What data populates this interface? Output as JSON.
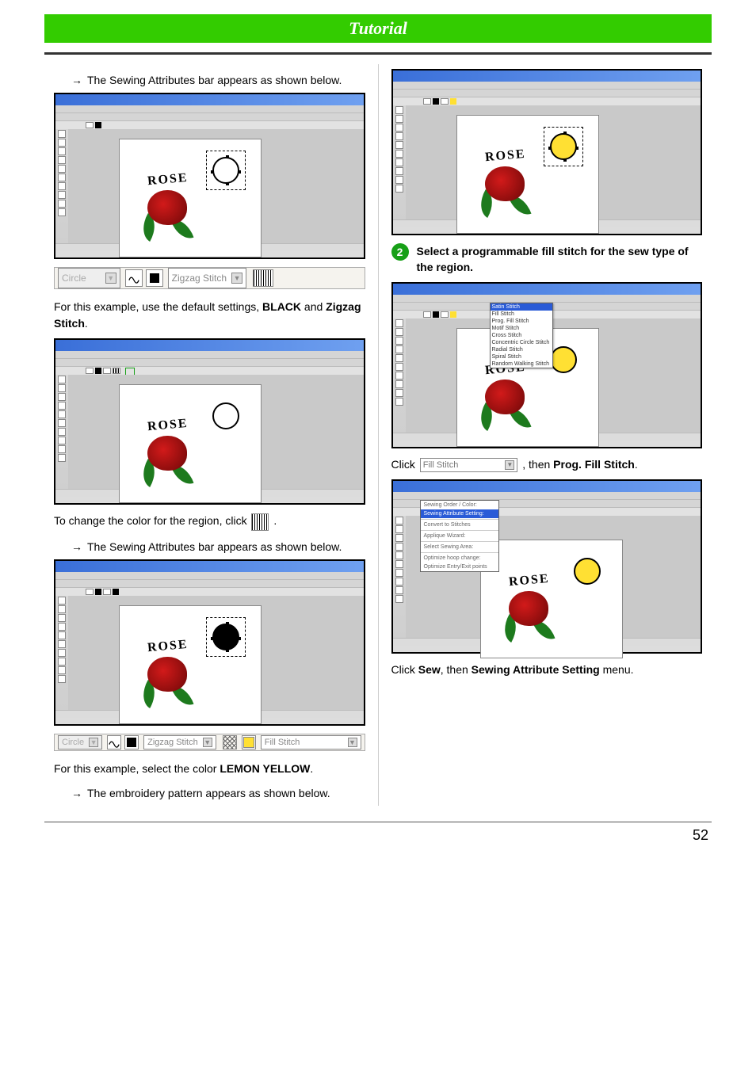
{
  "header": {
    "title": "Tutorial"
  },
  "left": {
    "arrow1": "The Sewing Attributes bar appears as shown below.",
    "attrbar1": {
      "circle": "Circle",
      "zigzag": "Zigzag Stitch"
    },
    "para1_a": "For this example, use the default settings, ",
    "para1_b": "BLACK",
    "para1_c": " and ",
    "para1_d": "Zigzag Stitch",
    "para1_e": ".",
    "para2_a": "To change the color for the region, click  ",
    "para2_b": " .",
    "arrow2": "The Sewing Attributes bar appears as shown below.",
    "attrbar2": {
      "circle": "Circle",
      "zigzag": "Zigzag Stitch",
      "fill": "Fill Stitch"
    },
    "para3_a": "For this example, select the color ",
    "para3_b": "LEMON YELLOW",
    "para3_c": ".",
    "arrow3": "The embroidery pattern appears as shown below."
  },
  "right": {
    "step2": "Select a programmable fill stitch for the sew type of the region.",
    "menu_items": {
      "highlight": "Satin Stitch",
      "a": "Fill Stitch",
      "b": "Prog. Fill Stitch",
      "c": "Motif Stitch",
      "d": "Cross Stitch",
      "e": "Concentric Circle Stitch",
      "f": "Radial Stitch",
      "g": "Spiral Stitch",
      "h": "Random Walking Stitch"
    },
    "click1_a": "Click ",
    "click1_dd": "Fill Stitch",
    "click1_b": ", then ",
    "click1_c": "Prog. Fill Stitch",
    "click1_d": ".",
    "sew_menu": {
      "header": "Sewing Order / Color:",
      "a": "Sewing Attribute Setting:",
      "b": "Convert to Stitches",
      "c": "Applique Wizard:",
      "d": "Select Sewing Area:",
      "e": "Optimize hoop change:",
      "f": "Optimize Entry/Exit points"
    },
    "click2_a": "Click ",
    "click2_b": "Sew",
    "click2_c": ", then ",
    "click2_d": "Sewing Attribute Setting",
    "click2_e": " menu."
  },
  "rose_text": "ROSE",
  "page_number": "52"
}
